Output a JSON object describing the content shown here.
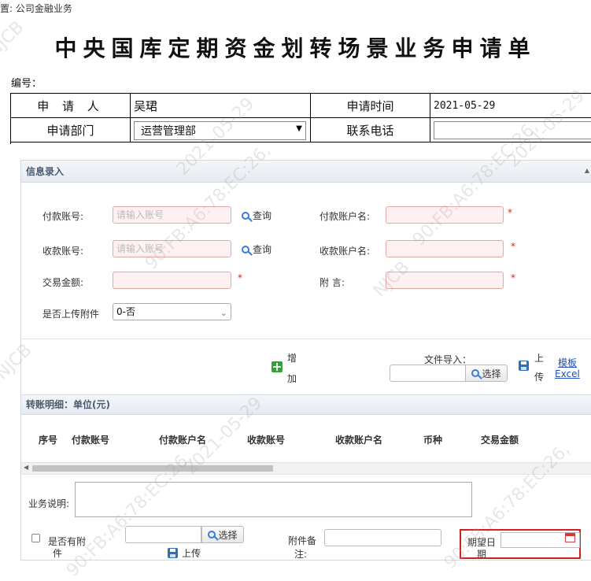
{
  "breadcrumb": "置: 公司金融业务",
  "title": "中央国库定期资金划转场景业务申请单",
  "number_label": "编号：",
  "header_table": {
    "applicant_label": "申 请 人",
    "applicant_value": "吴珺",
    "time_label": "申请时间",
    "time_value": "2021-05-29",
    "dept_label": "申请部门",
    "dept_value": "运营管理部",
    "phone_label": "联系电话",
    "phone_value": ""
  },
  "panel": {
    "title": "信息录入",
    "payer_account_label": "付款账号:",
    "payer_account_placeholder": "请输入账号",
    "payer_query": "查询",
    "payer_name_label": "付款账户名:",
    "payee_account_label": "收款账号:",
    "payee_account_placeholder": "请输入账号",
    "payee_query": "查询",
    "payee_name_label": "收款账户名:",
    "amount_label": "交易金额:",
    "remark_label": "附 言:",
    "required_mark": "*",
    "attach_label": "是否上传附件",
    "attach_value": "0-否",
    "add_label_1": "增",
    "add_label_2": "加",
    "file_import_label": "文件导入：",
    "choose_label": "选择",
    "upload_label_1": "上",
    "upload_label_2": "传",
    "template_label_1": "模板",
    "template_label_2": "Excel"
  },
  "details": {
    "title": "转账明细：单位(元)",
    "columns": [
      "序号",
      "付款账号",
      "付款账户名",
      "收款账号",
      "收款账户名",
      "币种",
      "交易金额"
    ]
  },
  "bottom": {
    "business_desc_label": "业务说明:",
    "has_attach_label_1": "是否有附",
    "has_attach_label_2": "件",
    "choose_label": "选择",
    "upload_label": "上传",
    "attach_note_label_1": "附件备",
    "attach_note_label_2": "注:",
    "expected_date_label_1": "期望日",
    "expected_date_label_2": "期"
  },
  "watermark": {
    "id": "NJCB",
    "mac": "90:FB:A6:78:EC:26,",
    "date": "2021-05-29"
  },
  "colors": {
    "required": "#e02020",
    "highlight_border": "#d61f1f",
    "panel_header": "#4a5b70"
  }
}
